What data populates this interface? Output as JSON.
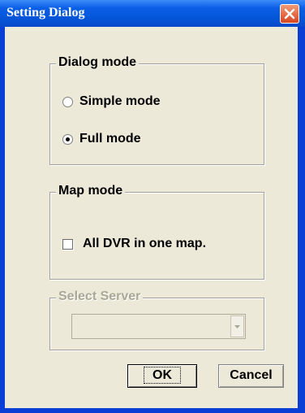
{
  "window": {
    "title": "Setting Dialog"
  },
  "dialog_mode": {
    "legend": "Dialog mode",
    "options": [
      {
        "label": "Simple mode",
        "selected": false
      },
      {
        "label": "Full mode",
        "selected": true
      }
    ]
  },
  "map_mode": {
    "legend": "Map mode",
    "checkbox": {
      "label": "All DVR in one map.",
      "checked": false
    }
  },
  "select_server": {
    "legend": "Select Server",
    "value": "",
    "enabled": false
  },
  "buttons": {
    "ok": "OK",
    "cancel": "Cancel"
  },
  "colors": {
    "titlebar": "#0555d8",
    "face": "#ece9d8",
    "close": "#d8451f"
  }
}
